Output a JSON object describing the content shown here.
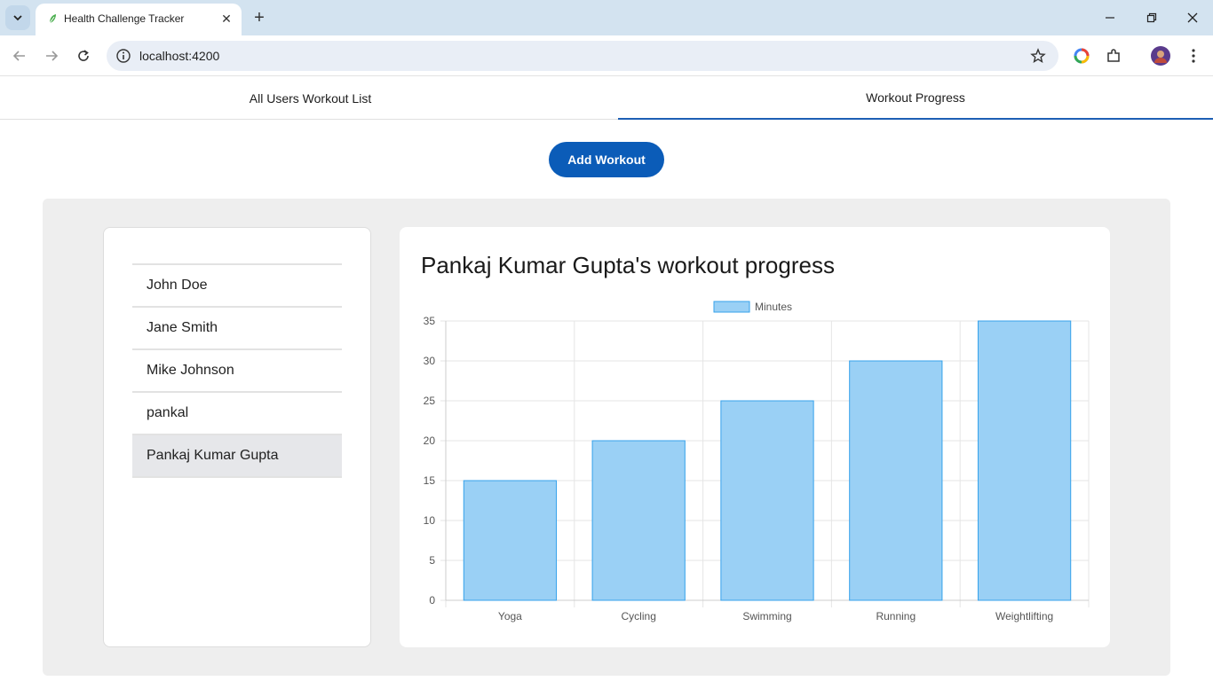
{
  "browser": {
    "tab_title": "Health Challenge Tracker",
    "url": "localhost:4200"
  },
  "app": {
    "tabs": [
      {
        "label": "All Users Workout List"
      },
      {
        "label": "Workout Progress"
      }
    ],
    "active_tab": 1,
    "add_button": "Add Workout",
    "users": [
      "John Doe",
      "Jane Smith",
      "Mike Johnson",
      "pankal",
      "Pankaj Kumar Gupta"
    ],
    "selected_user": 4,
    "chart_title": "Pankaj Kumar Gupta's workout progress"
  },
  "colors": {
    "accent": "#0b5cb8",
    "bar_fill": "#9ad0f5",
    "bar_border": "#36a2eb"
  },
  "chart_data": {
    "type": "bar",
    "categories": [
      "Yoga",
      "Cycling",
      "Swimming",
      "Running",
      "Weightlifting"
    ],
    "series": [
      {
        "name": "Minutes",
        "values": [
          15,
          20,
          25,
          30,
          35
        ]
      }
    ],
    "ylim": [
      0,
      35
    ],
    "yticks": [
      0,
      5,
      10,
      15,
      20,
      25,
      30,
      35
    ],
    "grid": true,
    "legend": "top-center"
  }
}
